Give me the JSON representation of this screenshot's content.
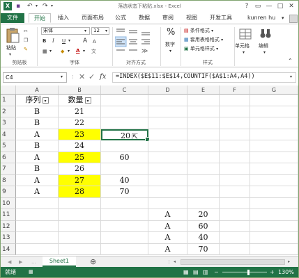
{
  "window": {
    "title": "落选状态下粘贴.xlsx - Excel",
    "controls": [
      "?",
      "▭",
      "—",
      "□",
      "✕"
    ]
  },
  "qat": {
    "save": "▪",
    "undo": "↶",
    "redo": "↷"
  },
  "tabs": [
    "文件",
    "开始",
    "插入",
    "页面布局",
    "公式",
    "数据",
    "审阅",
    "视图",
    "开发工具"
  ],
  "user": "kunren hu",
  "ribbon": {
    "paste_label": "粘贴",
    "clipboard_group": "剪贴板",
    "font_name": "宋体",
    "font_size": "12",
    "font_group": "字体",
    "bold": "B",
    "italic": "I",
    "underline": "U",
    "grow_font": "A",
    "shrink_font": "A",
    "align_group": "对齐方式",
    "number_label": "数字",
    "percent": "%",
    "cond_format": "条件格式",
    "table_format": "套用表格格式",
    "cell_style": "单元格样式",
    "style_group": "样式",
    "cells_label": "单元格",
    "edit_label": "编辑"
  },
  "formula_bar": {
    "name_box": "C4",
    "cancel": "✕",
    "enter": "✓",
    "fx": "fx",
    "formula": "=INDEX($E$11:$E$14,COUNTIF($A$1:A4,A4))"
  },
  "columns": [
    "A",
    "B",
    "C",
    "D",
    "E",
    "F",
    "G"
  ],
  "rows": [
    {
      "n": "1",
      "A": "序列",
      "B": "数量",
      "C": "",
      "D": "",
      "E": ""
    },
    {
      "n": "2",
      "A": "B",
      "B": "21",
      "C": "",
      "D": "",
      "E": ""
    },
    {
      "n": "3",
      "A": "B",
      "B": "22",
      "C": "",
      "D": "",
      "E": ""
    },
    {
      "n": "4",
      "A": "A",
      "B": "23",
      "C": "20",
      "D": "",
      "E": ""
    },
    {
      "n": "5",
      "A": "B",
      "B": "24",
      "C": "",
      "D": "",
      "E": ""
    },
    {
      "n": "6",
      "A": "A",
      "B": "25",
      "C": "60",
      "D": "",
      "E": ""
    },
    {
      "n": "7",
      "A": "B",
      "B": "26",
      "C": "",
      "D": "",
      "E": ""
    },
    {
      "n": "8",
      "A": "A",
      "B": "27",
      "C": "40",
      "D": "",
      "E": ""
    },
    {
      "n": "9",
      "A": "A",
      "B": "28",
      "C": "70",
      "D": "",
      "E": ""
    },
    {
      "n": "10",
      "A": "",
      "B": "",
      "C": "",
      "D": "",
      "E": ""
    },
    {
      "n": "11",
      "A": "",
      "B": "",
      "C": "",
      "D": "A",
      "E": "20"
    },
    {
      "n": "12",
      "A": "",
      "B": "",
      "C": "",
      "D": "A",
      "E": "60"
    },
    {
      "n": "13",
      "A": "",
      "B": "",
      "C": "",
      "D": "A",
      "E": "40"
    },
    {
      "n": "14",
      "A": "",
      "B": "",
      "C": "",
      "D": "A",
      "E": "70"
    }
  ],
  "highlight_color": "#ffff00",
  "accent_color": "#217346",
  "sheet_tab": "Sheet1",
  "add_sheet": "⊕",
  "status": {
    "mode": "就绪",
    "zoom": "130%"
  }
}
